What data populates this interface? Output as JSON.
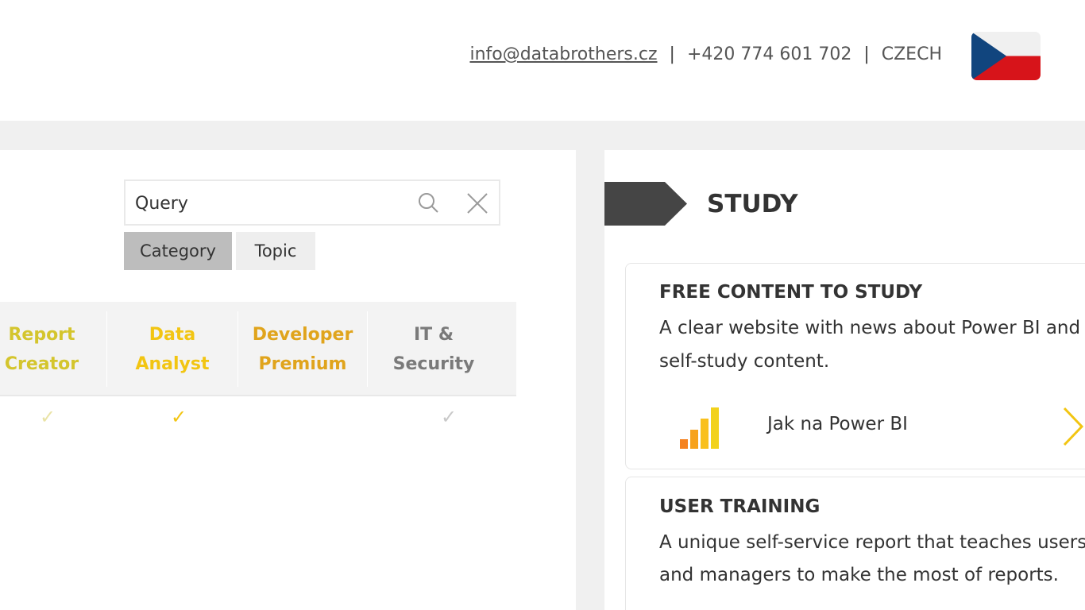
{
  "header": {
    "email": "info@databrothers.cz",
    "separator": "|",
    "phone": "+420 774 601 702",
    "language": "CZECH",
    "flag_icon": "czech-flag-icon"
  },
  "search": {
    "value": "Query",
    "search_icon": "search-icon",
    "clear_icon": "close-icon"
  },
  "filter_tabs": [
    {
      "label": "Category",
      "active": true
    },
    {
      "label": "Topic",
      "active": false
    }
  ],
  "roles": [
    {
      "line1": "Report",
      "line2": "Creator",
      "color": "#d4c52d",
      "check": "✓",
      "check_color": "#e9e3a6"
    },
    {
      "line1": "Data",
      "line2": "Analyst",
      "color": "#f2c512",
      "check": "✓",
      "check_color": "#f2c512"
    },
    {
      "line1": "Developer",
      "line2": "Premium",
      "color": "#e0a41c",
      "check": "",
      "check_color": "#e0a41c"
    },
    {
      "line1": "IT &",
      "line2": "Security",
      "color": "#7a7a7a",
      "check": "✓",
      "check_color": "#c8c8c8"
    }
  ],
  "study": {
    "title": "STUDY",
    "cards": [
      {
        "title": "FREE CONTENT TO STUDY",
        "desc_line1": "A clear website with news about Power BI and f",
        "desc_line2": "self-study content.",
        "link_label": "Jak na Power BI",
        "link_icon": "bar-chart-icon",
        "arrow_icon": "chevron-right-icon"
      },
      {
        "title": "USER TRAINING",
        "desc_line1": "A unique self-service report that teaches users",
        "desc_line2": "and managers to make the most of reports."
      }
    ]
  },
  "colors": {
    "accent_yellow": "#f2c512",
    "arrow_dark": "#454545",
    "tab_active": "#bdbdbd"
  }
}
